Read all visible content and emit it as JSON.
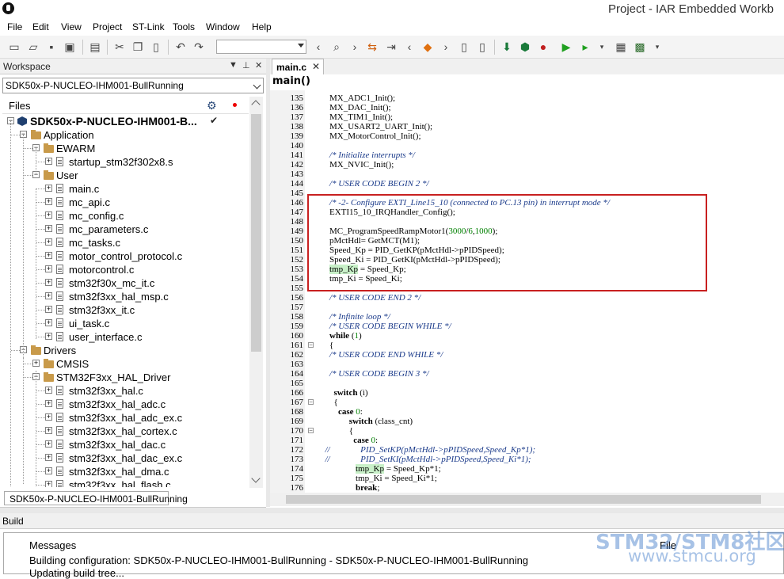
{
  "window": {
    "title": "Project - IAR Embedded Workb"
  },
  "menu": [
    "File",
    "Edit",
    "View",
    "Project",
    "ST-Link",
    "Tools",
    "Window",
    "Help"
  ],
  "workspace": {
    "title": "Workspace",
    "pin_symbol": "▼",
    "close_symbol": "✕",
    "configuration": "SDK50x-P-NUCLEO-IHM001-BullRunning",
    "files_label": "Files",
    "tab_label": "SDK50x-P-NUCLEO-IHM001-BullRunning",
    "tree": [
      {
        "label": "SDK50x-P-NUCLEO-IHM001-B...",
        "type": "project",
        "depth": 0
      },
      {
        "label": "Application",
        "type": "folder",
        "depth": 1
      },
      {
        "label": "EWARM",
        "type": "folder",
        "depth": 2
      },
      {
        "label": "startup_stm32f302x8.s",
        "type": "file",
        "depth": 3
      },
      {
        "label": "User",
        "type": "folder",
        "depth": 2
      },
      {
        "label": "main.c",
        "type": "file",
        "depth": 3
      },
      {
        "label": "mc_api.c",
        "type": "file",
        "depth": 3
      },
      {
        "label": "mc_config.c",
        "type": "file",
        "depth": 3
      },
      {
        "label": "mc_parameters.c",
        "type": "file",
        "depth": 3
      },
      {
        "label": "mc_tasks.c",
        "type": "file",
        "depth": 3
      },
      {
        "label": "motor_control_protocol.c",
        "type": "file",
        "depth": 3
      },
      {
        "label": "motorcontrol.c",
        "type": "file",
        "depth": 3
      },
      {
        "label": "stm32f30x_mc_it.c",
        "type": "file",
        "depth": 3
      },
      {
        "label": "stm32f3xx_hal_msp.c",
        "type": "file",
        "depth": 3
      },
      {
        "label": "stm32f3xx_it.c",
        "type": "file",
        "depth": 3
      },
      {
        "label": "ui_task.c",
        "type": "file",
        "depth": 3
      },
      {
        "label": "user_interface.c",
        "type": "file",
        "depth": 3
      },
      {
        "label": "Drivers",
        "type": "folder",
        "depth": 1
      },
      {
        "label": "CMSIS",
        "type": "folder",
        "depth": 2
      },
      {
        "label": "STM32F3xx_HAL_Driver",
        "type": "folder",
        "depth": 2
      },
      {
        "label": "stm32f3xx_hal.c",
        "type": "file",
        "depth": 3
      },
      {
        "label": "stm32f3xx_hal_adc.c",
        "type": "file",
        "depth": 3
      },
      {
        "label": "stm32f3xx_hal_adc_ex.c",
        "type": "file",
        "depth": 3
      },
      {
        "label": "stm32f3xx_hal_cortex.c",
        "type": "file",
        "depth": 3
      },
      {
        "label": "stm32f3xx_hal_dac.c",
        "type": "file",
        "depth": 3
      },
      {
        "label": "stm32f3xx_hal_dac_ex.c",
        "type": "file",
        "depth": 3
      },
      {
        "label": "stm32f3xx_hal_dma.c",
        "type": "file",
        "depth": 3
      },
      {
        "label": "stm32f3xx_hal_flash.c",
        "type": "file",
        "depth": 3
      }
    ]
  },
  "editor": {
    "tab_label": "main.c",
    "tab_close": "✕",
    "function_label": "main()",
    "lines": [
      {
        "n": "135",
        "fold": "",
        "t": [
          [
            "",
            "    MX_ADC1_Init();"
          ]
        ]
      },
      {
        "n": "136",
        "fold": "",
        "t": [
          [
            "",
            "    MX_DAC_Init();"
          ]
        ]
      },
      {
        "n": "137",
        "fold": "",
        "t": [
          [
            "",
            "    MX_TIM1_Init();"
          ]
        ]
      },
      {
        "n": "138",
        "fold": "",
        "t": [
          [
            "",
            "    MX_USART2_UART_Init();"
          ]
        ]
      },
      {
        "n": "139",
        "fold": "",
        "t": [
          [
            "",
            "    MX_MotorControl_Init();"
          ]
        ]
      },
      {
        "n": "140",
        "fold": "",
        "t": [
          [
            "",
            ""
          ]
        ]
      },
      {
        "n": "141",
        "fold": "",
        "t": [
          [
            "",
            "    "
          ],
          [
            "cm",
            "/* Initialize interrupts */"
          ]
        ]
      },
      {
        "n": "142",
        "fold": "",
        "t": [
          [
            "",
            "    MX_NVIC_Init();"
          ]
        ]
      },
      {
        "n": "143",
        "fold": "",
        "t": [
          [
            "",
            ""
          ]
        ]
      },
      {
        "n": "144",
        "fold": "",
        "t": [
          [
            "",
            "    "
          ],
          [
            "cm",
            "/* USER CODE BEGIN 2 */"
          ]
        ]
      },
      {
        "n": "145",
        "fold": "",
        "t": [
          [
            "",
            ""
          ]
        ]
      },
      {
        "n": "146",
        "fold": "",
        "t": [
          [
            "",
            "    "
          ],
          [
            "cm",
            "/* -2- Configure EXTI_Line15_10 (connected to PC.13 pin) in interrupt mode */"
          ]
        ]
      },
      {
        "n": "147",
        "fold": "",
        "t": [
          [
            "",
            "    EXTI15_10_IRQHandler_Config();"
          ]
        ]
      },
      {
        "n": "148",
        "fold": "",
        "t": [
          [
            "",
            ""
          ]
        ]
      },
      {
        "n": "149",
        "fold": "",
        "t": [
          [
            "",
            "    MC_ProgramSpeedRampMotor1("
          ],
          [
            "num",
            "3000"
          ],
          [
            "",
            "/"
          ],
          [
            "num",
            "6"
          ],
          [
            "",
            ","
          ],
          [
            "num",
            "1000"
          ],
          [
            "",
            ");"
          ]
        ]
      },
      {
        "n": "150",
        "fold": "",
        "t": [
          [
            "",
            "    pMctHdl= GetMCT(M1);"
          ]
        ]
      },
      {
        "n": "151",
        "fold": "",
        "t": [
          [
            "",
            "    Speed_Kp = PID_GetKP(pMctHdl->pPIDSpeed);"
          ]
        ]
      },
      {
        "n": "152",
        "fold": "",
        "t": [
          [
            "",
            "    Speed_Ki = PID_GetKI(pMctHdl->pPIDSpeed);"
          ]
        ]
      },
      {
        "n": "153",
        "fold": "",
        "t": [
          [
            "",
            "    "
          ],
          [
            "hlw",
            "tmp_Kp"
          ],
          [
            "",
            " = Speed_Kp;"
          ]
        ]
      },
      {
        "n": "154",
        "fold": "",
        "t": [
          [
            "",
            "    tmp_Ki = Speed_Ki;"
          ]
        ]
      },
      {
        "n": "155",
        "fold": "",
        "t": [
          [
            "",
            ""
          ]
        ]
      },
      {
        "n": "156",
        "fold": "",
        "t": [
          [
            "",
            "    "
          ],
          [
            "cm",
            "/* USER CODE END 2 */"
          ]
        ]
      },
      {
        "n": "157",
        "fold": "",
        "t": [
          [
            "",
            ""
          ]
        ]
      },
      {
        "n": "158",
        "fold": "",
        "t": [
          [
            "",
            "    "
          ],
          [
            "cm",
            "/* Infinite loop */"
          ]
        ]
      },
      {
        "n": "159",
        "fold": "",
        "t": [
          [
            "",
            "    "
          ],
          [
            "cm",
            "/* USER CODE BEGIN WHILE */"
          ]
        ]
      },
      {
        "n": "160",
        "fold": "",
        "t": [
          [
            "",
            "    "
          ],
          [
            "kw",
            "while"
          ],
          [
            "",
            " ("
          ],
          [
            "num",
            "1"
          ],
          [
            "",
            ")"
          ]
        ]
      },
      {
        "n": "161",
        "fold": "−",
        "t": [
          [
            "",
            "    {"
          ]
        ]
      },
      {
        "n": "162",
        "fold": "",
        "t": [
          [
            "",
            "    "
          ],
          [
            "cm",
            "/* USER CODE END WHILE */"
          ]
        ]
      },
      {
        "n": "163",
        "fold": "",
        "t": [
          [
            "",
            ""
          ]
        ]
      },
      {
        "n": "164",
        "fold": "",
        "t": [
          [
            "",
            "    "
          ],
          [
            "cm",
            "/* USER CODE BEGIN 3 */"
          ]
        ]
      },
      {
        "n": "165",
        "fold": "",
        "t": [
          [
            "",
            ""
          ]
        ]
      },
      {
        "n": "166",
        "fold": "",
        "t": [
          [
            "",
            "      "
          ],
          [
            "kw",
            "switch"
          ],
          [
            "",
            " (i)"
          ]
        ]
      },
      {
        "n": "167",
        "fold": "−",
        "t": [
          [
            "",
            "      {"
          ]
        ]
      },
      {
        "n": "168",
        "fold": "",
        "t": [
          [
            "",
            "        "
          ],
          [
            "kw",
            "case"
          ],
          [
            "",
            " "
          ],
          [
            "num",
            "0"
          ],
          [
            "",
            ":"
          ]
        ]
      },
      {
        "n": "169",
        "fold": "",
        "t": [
          [
            "",
            "             "
          ],
          [
            "kw",
            "switch"
          ],
          [
            "",
            " (class_cnt)"
          ]
        ]
      },
      {
        "n": "170",
        "fold": "−",
        "t": [
          [
            "",
            "             {"
          ]
        ]
      },
      {
        "n": "171",
        "fold": "",
        "t": [
          [
            "",
            "               "
          ],
          [
            "kw",
            "case"
          ],
          [
            "",
            " "
          ],
          [
            "num",
            "0"
          ],
          [
            "",
            ":"
          ]
        ]
      },
      {
        "n": "172",
        "fold": "",
        "t": [
          [
            "",
            "  "
          ],
          [
            "cm",
            "//              PID_SetKP(pMctHdl->pPIDSpeed,Speed_Kp*1);"
          ]
        ]
      },
      {
        "n": "173",
        "fold": "",
        "t": [
          [
            "",
            "  "
          ],
          [
            "cm",
            "//              PID_SetKI(pMctHdl->pPIDSpeed,Speed_Ki*1);"
          ]
        ]
      },
      {
        "n": "174",
        "fold": "",
        "t": [
          [
            "",
            "                "
          ],
          [
            "hlw",
            "tmp_Kp"
          ],
          [
            "",
            " = Speed_Kp*1;"
          ]
        ]
      },
      {
        "n": "175",
        "fold": "",
        "t": [
          [
            "",
            "                tmp_Ki = Speed_Ki*1;"
          ]
        ]
      },
      {
        "n": "176",
        "fold": "",
        "t": [
          [
            "",
            "                "
          ],
          [
            "kw",
            "break"
          ],
          [
            "",
            ";"
          ]
        ]
      }
    ]
  },
  "build": {
    "title": "Build",
    "col_messages": "Messages",
    "col_file": "File",
    "messages": [
      "Building configuration: SDK50x-P-NUCLEO-IHM001-BullRunning - SDK50x-P-NUCLEO-IHM001-BullRunning",
      "Updating build tree..."
    ]
  },
  "watermark": {
    "line1": "STM32/STM8社区",
    "line2": "www.stmcu.org"
  },
  "colors": {
    "accent_highlight": "#c8f0c8",
    "annotation_box": "#c82020",
    "comment": "#1a3a8a"
  }
}
